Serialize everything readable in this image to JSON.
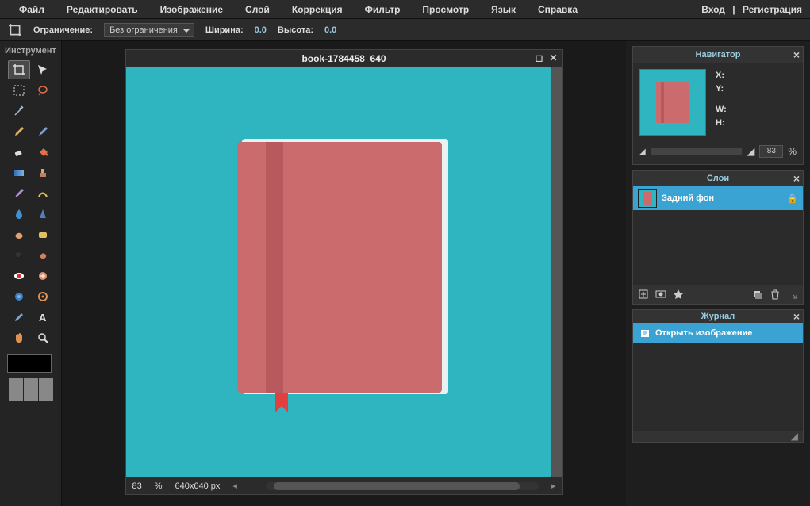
{
  "menu": {
    "file": "Файл",
    "edit": "Редактировать",
    "image": "Изображение",
    "layer": "Слой",
    "adjust": "Коррекция",
    "filter": "Фильтр",
    "view": "Просмотр",
    "lang": "Язык",
    "help": "Справка"
  },
  "auth": {
    "login": "Вход",
    "sep": "|",
    "register": "Регистрация"
  },
  "options": {
    "constraint_label": "Ограничение:",
    "constraint_value": "Без ограничения",
    "width_label": "Ширина:",
    "width_value": "0.0",
    "height_label": "Высота:",
    "height_value": "0.0"
  },
  "toolbox": {
    "title": "Инструмент"
  },
  "document": {
    "title": "book-1784458_640",
    "zoom": "83",
    "zoom_unit": "%",
    "dims": "640x640 px"
  },
  "navigator": {
    "title": "Навигатор",
    "x": "X:",
    "y": "Y:",
    "w": "W:",
    "h": "H:",
    "zoom": "83",
    "zoom_unit": "%"
  },
  "layers": {
    "title": "Слои",
    "bg": "Задний фон"
  },
  "history": {
    "title": "Журнал",
    "open": "Открыть изображение"
  }
}
